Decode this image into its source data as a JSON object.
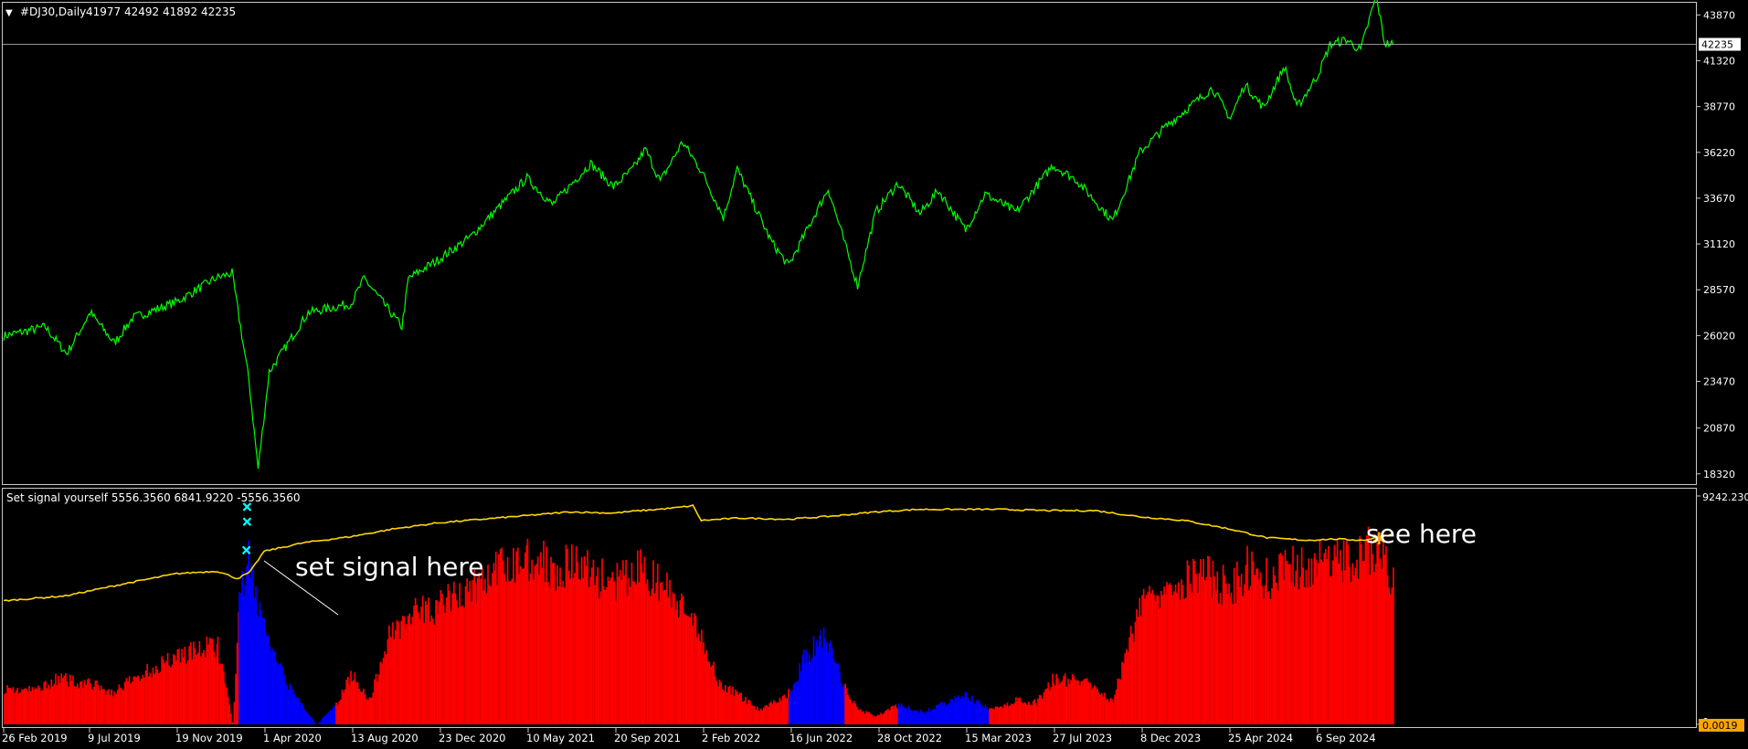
{
  "window": {
    "title": "#DJ30,Daily",
    "ohlc": "41977 42492 41892 42235"
  },
  "indicator": {
    "title": "Set signal yourself 5556.3560 6841.9220 -5556.3560",
    "top_label": "9242.230",
    "zero_label": "0",
    "current_label": "0.0019"
  },
  "annotations": {
    "signal_text": "set signal here",
    "see_text": "see here"
  },
  "colors": {
    "background": "#000000",
    "price_line": "#00ff00",
    "signal_line": "#ffd700",
    "histogram_up": "#ff0000",
    "histogram_down": "#0000ff",
    "markers": "#00ffff",
    "axis": "#c8c8c8"
  },
  "chart_data": [
    {
      "type": "line",
      "title": "#DJ30,Daily",
      "ylim": [
        17800,
        44500
      ],
      "yticks": [
        43870,
        41320,
        38770,
        36220,
        33670,
        31120,
        28570,
        26020,
        23470,
        20870,
        18320
      ],
      "current_price": 42235,
      "current_price_label": "42235",
      "xlabels": [
        "26 Feb 2019",
        "9 Jul 2019",
        "19 Nov 2019",
        "1 Apr 2020",
        "13 Aug 2020",
        "23 Dec 2020",
        "10 May 2021",
        "20 Sep 2021",
        "2 Feb 2022",
        "16 Jun 2022",
        "28 Oct 2022",
        "15 Mar 2023",
        "27 Jul 2023",
        "8 Dec 2023",
        "25 Apr 2024",
        "6 Sep 2024"
      ],
      "series": [
        {
          "x": [
            "2019-02-26",
            "2019-05-01",
            "2019-06-03",
            "2019-07-09",
            "2019-08-15",
            "2019-09-12",
            "2019-11-19",
            "2020-01-17",
            "2020-02-12",
            "2020-03-09",
            "2020-03-23",
            "2020-04-09",
            "2020-06-08",
            "2020-08-13",
            "2020-09-02",
            "2020-10-30",
            "2020-11-09",
            "2020-12-23",
            "2021-02-12",
            "2021-05-10",
            "2021-06-18",
            "2021-08-16",
            "2021-09-20",
            "2021-10-20",
            "2021-11-08",
            "2021-12-01",
            "2022-01-04",
            "2022-02-02",
            "2022-03-08",
            "2022-03-29",
            "2022-05-20",
            "2022-06-16",
            "2022-08-16",
            "2022-09-30",
            "2022-10-28",
            "2022-12-01",
            "2023-01-04",
            "2023-02-01",
            "2023-03-15",
            "2023-04-14",
            "2023-06-01",
            "2023-07-27",
            "2023-09-01",
            "2023-10-27",
            "2023-12-08",
            "2024-01-15",
            "2024-03-28",
            "2024-04-25",
            "2024-05-17",
            "2024-06-15",
            "2024-07-17",
            "2024-08-05",
            "2024-09-06",
            "2024-09-25",
            "2024-10-20",
            "2024-11-11",
            "2024-12-05",
            "2024-12-18",
            "2024-12-31"
          ],
          "values": [
            26000,
            26500,
            25000,
            27300,
            25600,
            27000,
            27900,
            29200,
            29500,
            23500,
            18600,
            24000,
            27300,
            27800,
            29200,
            26500,
            29200,
            30200,
            31500,
            34800,
            33300,
            35600,
            34300,
            35300,
            36400,
            34600,
            36800,
            35200,
            32600,
            35300,
            31300,
            29900,
            34200,
            28800,
            32900,
            34500,
            32800,
            34100,
            31900,
            33900,
            32900,
            35500,
            34700,
            32400,
            36250,
            37600,
            39800,
            38100,
            40000,
            38700,
            41000,
            38700,
            40500,
            42200,
            42500,
            41900,
            44950,
            42300,
            42235
          ]
        }
      ]
    },
    {
      "type": "bar",
      "title": "Set signal yourself 5556.3560 6841.9220 -5556.3560",
      "ylim": [
        0,
        9242.23
      ],
      "yticks": [
        9242.23,
        0
      ],
      "xlabels": [
        "26 Feb 2019",
        "9 Jul 2019",
        "19 Nov 2019",
        "1 Apr 2020",
        "13 Aug 2020",
        "23 Dec 2020",
        "10 May 2021",
        "20 Sep 2021",
        "2 Feb 2022",
        "16 Jun 2022",
        "28 Oct 2022",
        "15 Mar 2023",
        "27 Jul 2023",
        "8 Dec 2023",
        "25 Apr 2024",
        "6 Sep 2024"
      ],
      "series": [
        {
          "name": "",
          "kind": "histogram",
          "x": [
            "2019-02-26",
            "2019-04-10",
            "2019-05-20",
            "2019-07-09",
            "2019-08-10",
            "2019-09-20",
            "2019-11-19",
            "2020-01-20",
            "2020-02-12",
            "2020-02-22",
            "2020-03-05",
            "2020-03-20",
            "2020-04-15",
            "2020-05-15",
            "2020-06-20",
            "2020-07-20",
            "2020-08-13",
            "2020-09-10",
            "2020-10-10",
            "2020-11-05",
            "2020-12-23",
            "2021-02-20",
            "2021-03-20",
            "2021-05-10",
            "2021-06-20",
            "2021-08-01",
            "2021-09-20",
            "2021-11-01",
            "2021-12-10",
            "2022-01-10",
            "2022-02-02",
            "2022-03-01",
            "2022-04-01",
            "2022-05-01",
            "2022-06-16",
            "2022-07-10",
            "2022-08-10",
            "2022-09-10",
            "2022-10-01",
            "2022-10-28",
            "2022-12-01",
            "2023-01-10",
            "2023-02-10",
            "2023-03-15",
            "2023-04-20",
            "2023-06-01",
            "2023-07-01",
            "2023-07-27",
            "2023-09-10",
            "2023-10-27",
            "2023-12-08",
            "2024-01-15",
            "2024-02-20",
            "2024-03-28",
            "2024-04-25",
            "2024-05-20",
            "2024-06-20",
            "2024-07-20",
            "2024-08-20",
            "2024-09-06",
            "2024-10-15",
            "2024-11-15",
            "2024-12-10",
            "2024-12-31"
          ],
          "values": [
            1500,
            1400,
            1900,
            1700,
            1300,
            2000,
            2900,
            3300,
            0,
            4800,
            7000,
            5200,
            2800,
            1300,
            0,
            800,
            2100,
            1000,
            3800,
            4500,
            4900,
            5800,
            6300,
            7000,
            6600,
            6600,
            5800,
            6500,
            5600,
            4500,
            3600,
            1700,
            1200,
            600,
            1300,
            2800,
            3700,
            1500,
            600,
            350,
            800,
            500,
            900,
            1200,
            600,
            1000,
            900,
            1900,
            1800,
            1000,
            5100,
            5900,
            6200,
            6100,
            5600,
            6500,
            6100,
            6400,
            6600,
            6700,
            6900,
            7000,
            7600,
            5600
          ],
          "sign": [
            "up",
            "up",
            "up",
            "up",
            "up",
            "up",
            "up",
            "up",
            "up",
            "down",
            "down",
            "down",
            "down",
            "down",
            "down",
            "up",
            "up",
            "up",
            "up",
            "up",
            "up",
            "up",
            "up",
            "up",
            "up",
            "up",
            "up",
            "up",
            "up",
            "up",
            "up",
            "up",
            "up",
            "up",
            "down",
            "down",
            "down",
            "up",
            "up",
            "up",
            "down",
            "down",
            "down",
            "down",
            "up",
            "up",
            "up",
            "up",
            "up",
            "up",
            "up",
            "up",
            "up",
            "up",
            "up",
            "up",
            "up",
            "up",
            "up",
            "up",
            "up",
            "up",
            "up",
            "up"
          ]
        },
        {
          "name": "",
          "kind": "line",
          "x": [
            "2019-02-26",
            "2019-06-01",
            "2019-09-01",
            "2019-11-19",
            "2020-01-20",
            "2020-02-20",
            "2020-03-10",
            "2020-04-01",
            "2020-06-01",
            "2020-08-13",
            "2020-10-15",
            "2020-12-23",
            "2021-03-01",
            "2021-05-10",
            "2021-07-15",
            "2021-09-20",
            "2021-11-01",
            "2021-12-20",
            "2022-01-20",
            "2022-02-02",
            "2022-04-01",
            "2022-06-16",
            "2022-09-01",
            "2022-10-28",
            "2023-01-01",
            "2023-03-15",
            "2023-05-01",
            "2023-07-27",
            "2023-10-01",
            "2023-12-08",
            "2024-02-15",
            "2024-04-25",
            "2024-06-20",
            "2024-08-20",
            "2024-10-01",
            "2024-11-15",
            "2024-12-31"
          ],
          "values": [
            5000,
            5200,
            5700,
            6100,
            6200,
            5900,
            6150,
            7000,
            7350,
            7600,
            7900,
            8150,
            8300,
            8450,
            8600,
            8550,
            8650,
            8750,
            8850,
            8250,
            8350,
            8300,
            8450,
            8600,
            8700,
            8700,
            8700,
            8650,
            8650,
            8400,
            8250,
            7900,
            7550,
            7450,
            7500,
            7450,
            7700
          ]
        }
      ],
      "markers": [
        {
          "x": "2020-03-06",
          "y": 8800,
          "symbol": "x"
        },
        {
          "x": "2020-03-06",
          "y": 8200,
          "symbol": "x"
        },
        {
          "x": "2020-03-05",
          "y": 7050,
          "symbol": "x"
        },
        {
          "x": "2024-12-10",
          "y": 7500,
          "symbol": "star"
        }
      ]
    }
  ]
}
